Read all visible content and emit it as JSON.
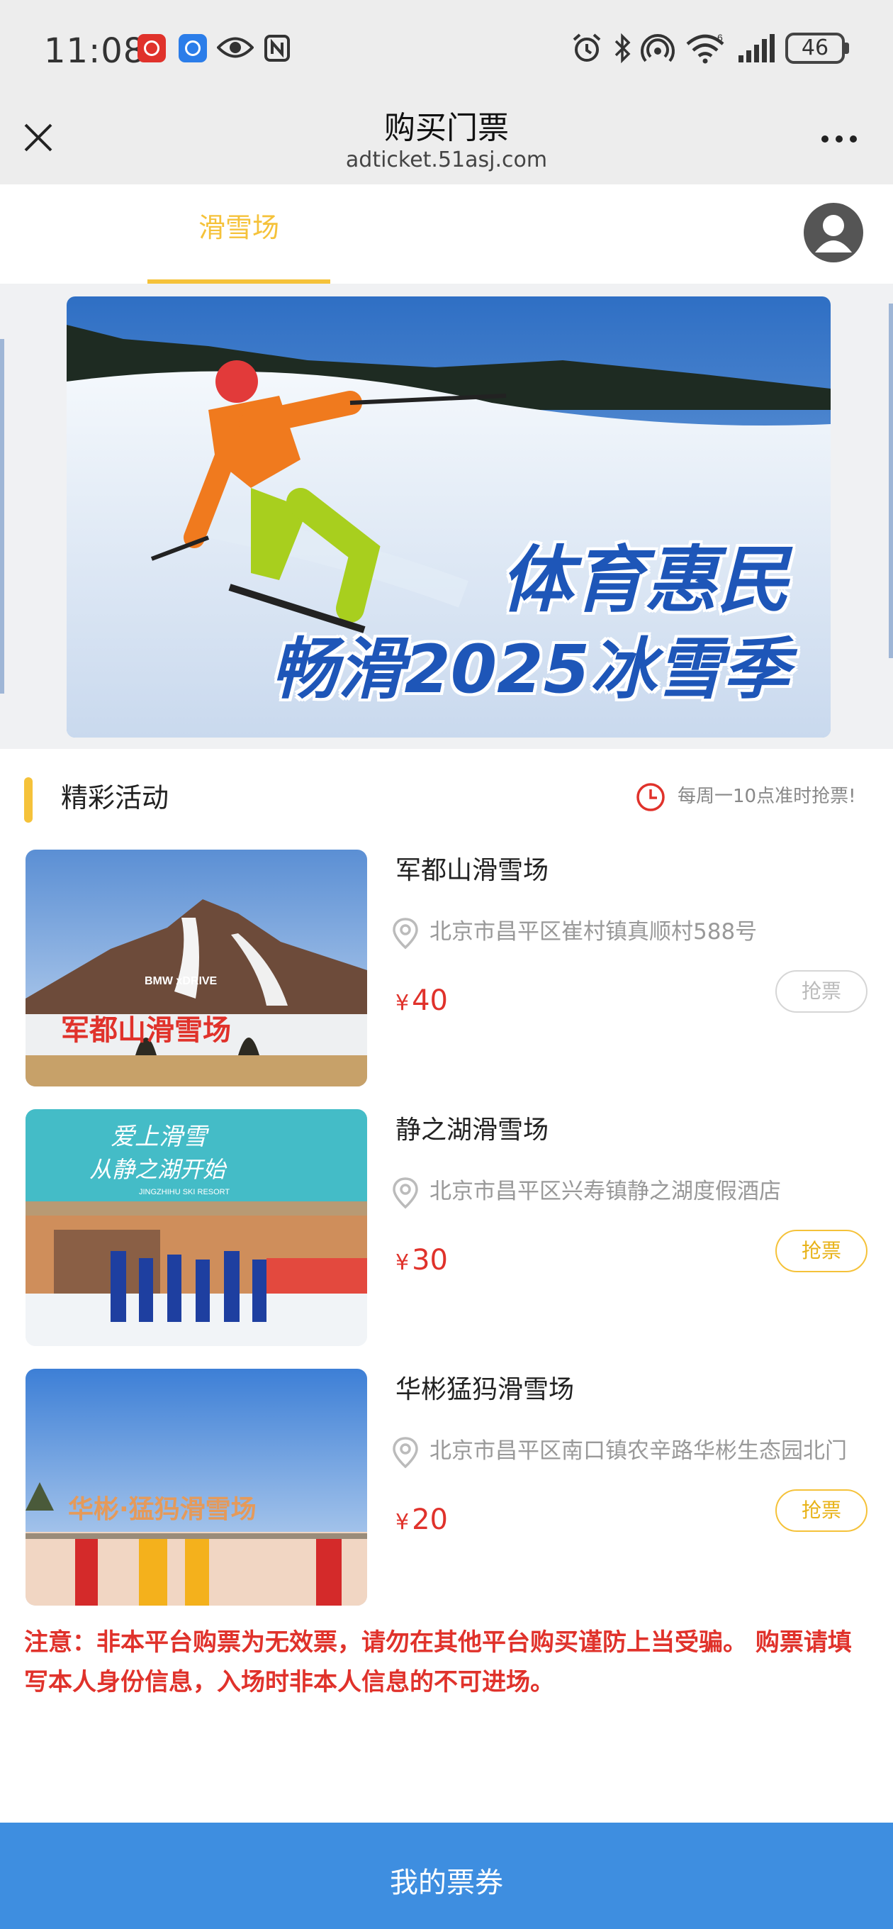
{
  "status_bar": {
    "time": "11:08",
    "battery": "46",
    "icons": [
      "app-red-badge-icon",
      "app-blue-badge-icon",
      "eye-icon",
      "nfc-icon",
      "alarm-icon",
      "bluetooth-icon",
      "hotspot-icon",
      "wifi-icon",
      "signal-icon",
      "battery-icon"
    ]
  },
  "title_bar": {
    "title": "购买门票",
    "url": "adticket.51asj.com"
  },
  "tabs": [
    {
      "label": "滑雪场",
      "active": true
    }
  ],
  "banner": {
    "line1": "体育惠民",
    "line2": "畅滑2025冰雪季"
  },
  "section": {
    "title": "精彩活动",
    "note": "每周一10点准时抢票!"
  },
  "venues": [
    {
      "name": "军都山滑雪场",
      "address": "北京市昌平区崔村镇真顺村588号",
      "currency": "¥",
      "price": "40",
      "button": "抢票",
      "button_enabled": false,
      "image_caption": "军都山滑雪场",
      "image_sign": "BMW xDRIVE"
    },
    {
      "name": "静之湖滑雪场",
      "address": "北京市昌平区兴寿镇静之湖度假酒店",
      "currency": "¥",
      "price": "30",
      "button": "抢票",
      "button_enabled": true,
      "image_caption": "爱上滑雪",
      "image_caption2": "从静之湖开始",
      "image_sign": "JINGZHIHU SKI RESORT"
    },
    {
      "name": "华彬猛犸滑雪场",
      "address": "北京市昌平区南口镇农辛路华彬生态园北门",
      "currency": "¥",
      "price": "20",
      "button": "抢票",
      "button_enabled": true,
      "image_caption": "华彬·猛犸滑雪场"
    }
  ],
  "notice": "注意：非本平台购票为无效票，请勿在其他平台购买谨防上当受骗。 购票请填写本人身份信息，入场时非本人信息的不可进场。",
  "bottom_bar": {
    "label": "我的票券"
  },
  "colors": {
    "accent": "#f5c23a",
    "price": "#e0322b",
    "bottom_bar": "#3e8ee0"
  }
}
